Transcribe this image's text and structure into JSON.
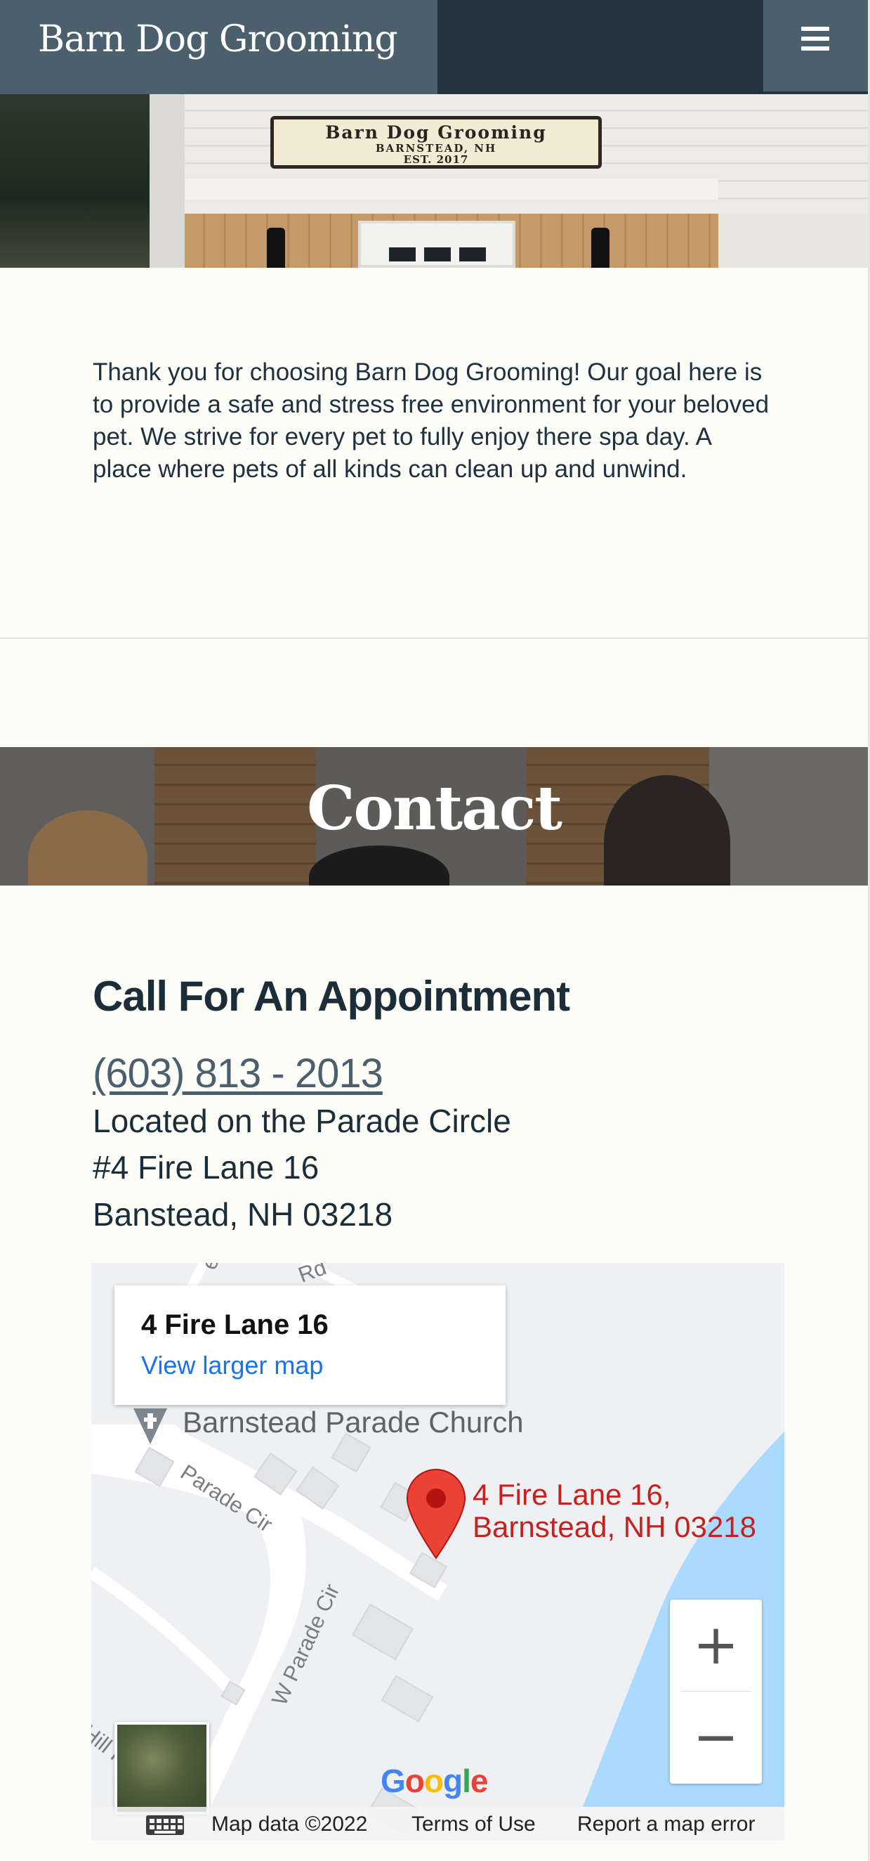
{
  "header": {
    "brand": "Barn Dog Grooming",
    "menu_icon": "hamburger-menu-icon"
  },
  "hero": {
    "sign_line1": "Barn Dog Grooming",
    "sign_line2": "BARNSTEAD, NH",
    "sign_line3": "EST. 2017"
  },
  "intro": {
    "text": "Thank you for choosing Barn Dog Grooming! Our goal here is to provide a safe and stress free environment for your beloved pet. We strive for every pet to fully enjoy there spa day. A place where pets of all kinds can clean up and unwind."
  },
  "contact": {
    "title": "Contact",
    "heading": "Call For An Appointment",
    "phone": "(603) 813 - 2013",
    "address_lines": [
      "Located on the Parade Circle",
      "#4 Fire Lane 16",
      "Banstead, NH 03218"
    ]
  },
  "map": {
    "info_title": "4 Fire Lane 16",
    "info_link": "View larger map",
    "church_label": "Barnstead Parade Church",
    "pin_label_line1": "4 Fire Lane 16,",
    "pin_label_line2": "Barnstead, NH 03218",
    "streets": [
      "Parade Cir",
      "W Parade Cir",
      "Hill Rd",
      "Rd",
      "ea"
    ],
    "zoom_in": "+",
    "zoom_out": "−",
    "google_logo": [
      "G",
      "o",
      "o",
      "g",
      "l",
      "e"
    ],
    "footer": {
      "map_data": "Map data ©2022",
      "terms": "Terms of Use",
      "report": "Report a map error"
    },
    "colors": {
      "water": "#aadaff",
      "pin": "#ea4335",
      "link": "#1a73e8",
      "pin_label": "#c5221f"
    }
  },
  "colors": {
    "nav_dark": "#24333f",
    "nav_slate": "#4c5f6d",
    "page_bg": "#fcfdf6",
    "text": "#1c2d3a"
  }
}
